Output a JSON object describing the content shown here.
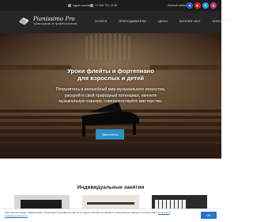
{
  "topbar": {
    "address": "Адрес школы",
    "phone": "+7 916 721 13 36",
    "cabinet": "Личный кабинет",
    "socials": [
      {
        "icon": "vk-icon",
        "glyph": "в",
        "color": "#2a64c9"
      },
      {
        "icon": "youtube-icon",
        "glyph": "▶",
        "color": "#e02020"
      },
      {
        "icon": "telegram-icon",
        "glyph": "➤",
        "color": "#23a0dc"
      },
      {
        "icon": "instagram-icon",
        "glyph": "◎",
        "color": "#c4307a"
      }
    ]
  },
  "header": {
    "logo_title": "Pianissimo Pro",
    "logo_subtitle": "Уроки музыки от профессионалов",
    "nav": [
      "УСЛУГИ",
      "ПРЕПОДАВАТЕЛИ",
      "ЦЕНЫ",
      "КАТАЛОГ НОТ",
      "КОНТАКТЫ"
    ]
  },
  "hero": {
    "title_line1": "Уроки флейты и фортепиано",
    "title_line2": "для взрослых и детей",
    "description": "Погрузитесь в волшебный мир музыкального искусства, раскройте свой природный потенциал, начните музыкальную карьеру, совершенствуйте мастерство.",
    "cta_label": "Записаться"
  },
  "section": {
    "title": "Индивидуальные занятия"
  },
  "cookie": {
    "text": "Наш сайт использует файлы cookie. Продолжая пользоваться сайтом, вы даете согласие на обработку персональных данных в соответствии с",
    "link": "Политикой конфиденциальности",
    "button": "OK"
  },
  "colors": {
    "topbar_bg": "#1c1c1c",
    "header_bg": "#262626",
    "accent": "#2f8fc9",
    "cookie_button": "#2a73c9"
  }
}
